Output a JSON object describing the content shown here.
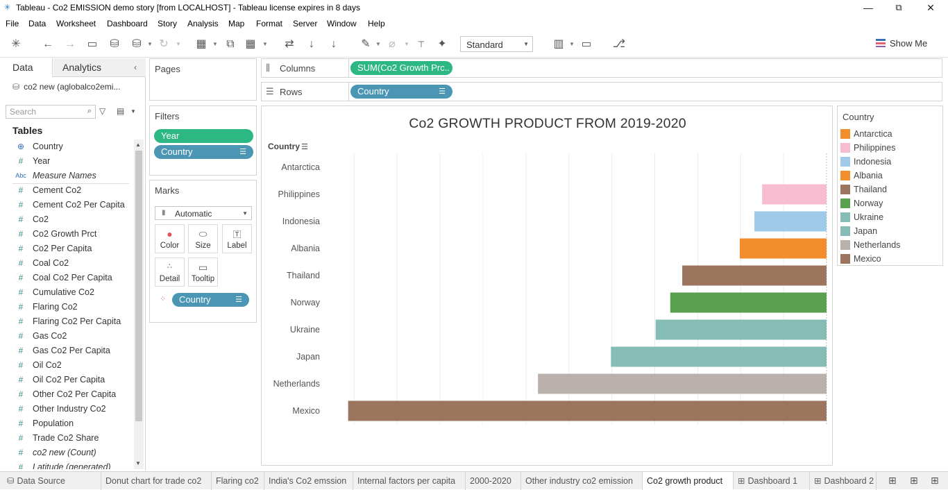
{
  "window": {
    "title": "Tableau - Co2 EMISSION demo story [from LOCALHOST] - Tableau license expires in 8 days",
    "minimize": "—",
    "restore": "⧉",
    "close": "✕"
  },
  "menu": [
    "File",
    "Data",
    "Worksheet",
    "Dashboard",
    "Story",
    "Analysis",
    "Map",
    "Format",
    "Server",
    "Window",
    "Help"
  ],
  "toolbar": {
    "fit_label": "Standard",
    "show_me_label": "Show Me"
  },
  "left_panel": {
    "tab_data": "Data",
    "tab_analytics": "Analytics",
    "datasource": "co2 new (aglobalco2emi...",
    "search_placeholder": "Search",
    "tables_heading": "Tables",
    "fields": [
      {
        "name": "Country",
        "icon": "globe-icon",
        "italic": false
      },
      {
        "name": "Year",
        "icon": "hash-icon",
        "italic": false
      },
      {
        "name": "Measure Names",
        "icon": "abc-icon",
        "italic": true
      },
      {
        "name": "Cement Co2",
        "icon": "hash-icon",
        "italic": false
      },
      {
        "name": "Cement Co2 Per Capita",
        "icon": "hash-icon",
        "italic": false
      },
      {
        "name": "Co2",
        "icon": "hash-icon",
        "italic": false
      },
      {
        "name": "Co2 Growth Prct",
        "icon": "hash-icon",
        "italic": false
      },
      {
        "name": "Co2 Per Capita",
        "icon": "hash-icon",
        "italic": false
      },
      {
        "name": "Coal Co2",
        "icon": "hash-icon",
        "italic": false
      },
      {
        "name": "Coal Co2 Per Capita",
        "icon": "hash-icon",
        "italic": false
      },
      {
        "name": "Cumulative Co2",
        "icon": "hash-icon",
        "italic": false
      },
      {
        "name": "Flaring Co2",
        "icon": "hash-icon",
        "italic": false
      },
      {
        "name": "Flaring Co2 Per Capita",
        "icon": "hash-icon",
        "italic": false
      },
      {
        "name": "Gas Co2",
        "icon": "hash-icon",
        "italic": false
      },
      {
        "name": "Gas Co2 Per Capita",
        "icon": "hash-icon",
        "italic": false
      },
      {
        "name": "Oil Co2",
        "icon": "hash-icon",
        "italic": false
      },
      {
        "name": "Oil Co2 Per Capita",
        "icon": "hash-icon",
        "italic": false
      },
      {
        "name": "Other Co2 Per Capita",
        "icon": "hash-icon",
        "italic": false
      },
      {
        "name": "Other Industry Co2",
        "icon": "hash-icon",
        "italic": false
      },
      {
        "name": "Population",
        "icon": "hash-icon",
        "italic": false
      },
      {
        "name": "Trade Co2 Share",
        "icon": "hash-icon",
        "italic": false
      },
      {
        "name": "co2 new (Count)",
        "icon": "hash-icon",
        "italic": true
      },
      {
        "name": "Latitude (generated)",
        "icon": "hash-icon",
        "italic": true
      }
    ]
  },
  "cards": {
    "pages_title": "Pages",
    "filters_title": "Filters",
    "filters": [
      "Year",
      "Country"
    ],
    "marks_title": "Marks",
    "mark_type": "Automatic",
    "mark_buttons": [
      "Color",
      "Size",
      "Label",
      "Detail",
      "Tooltip"
    ],
    "color_pill": "Country"
  },
  "shelves": {
    "columns_label": "Columns",
    "columns_pill": "SUM(Co2 Growth Prc..",
    "rows_label": "Rows",
    "rows_pill": "Country"
  },
  "legend": {
    "title": "Country"
  },
  "chart_data": {
    "type": "bar",
    "orientation": "horizontal",
    "title": "Co2 GROWTH PRODUCT FROM 2019-2020",
    "row_header": "Country",
    "categories": [
      "Antarctica",
      "Philippines",
      "Indonesia",
      "Albania",
      "Thailand",
      "Norway",
      "Ukraine",
      "Japan",
      "Netherlands",
      "Mexico"
    ],
    "values": [
      0,
      -0.75,
      -0.84,
      -1.01,
      -1.68,
      -1.82,
      -1.99,
      -2.51,
      -3.36,
      -5.57
    ],
    "colors": [
      "#f28e2b",
      "#f7bcd0",
      "#a0cbe8",
      "#f28e2b",
      "#9c755f",
      "#59a14f",
      "#86bcb6",
      "#86bcb6",
      "#bab0ac",
      "#9c755f"
    ],
    "x_range": [
      -5.85,
      0
    ],
    "grid": true,
    "legend_position": "right"
  },
  "bottom_tabs": [
    {
      "label": "Data Source",
      "icon": "database-icon",
      "active": false
    },
    {
      "label": "Donut chart for trade co2",
      "icon": "",
      "active": false
    },
    {
      "label": "Flaring co2",
      "icon": "",
      "active": false
    },
    {
      "label": "India's Co2 emssion",
      "icon": "",
      "active": false
    },
    {
      "label": "Internal factors per capita",
      "icon": "",
      "active": false
    },
    {
      "label": "2000-2020",
      "icon": "",
      "active": false
    },
    {
      "label": "Other industry co2 emission",
      "icon": "",
      "active": false
    },
    {
      "label": "Co2 growth product",
      "icon": "",
      "active": true
    },
    {
      "label": "Dashboard 1",
      "icon": "dashboard-icon",
      "active": false
    },
    {
      "label": "Dashboard 2",
      "icon": "dashboard-icon",
      "active": false
    }
  ]
}
